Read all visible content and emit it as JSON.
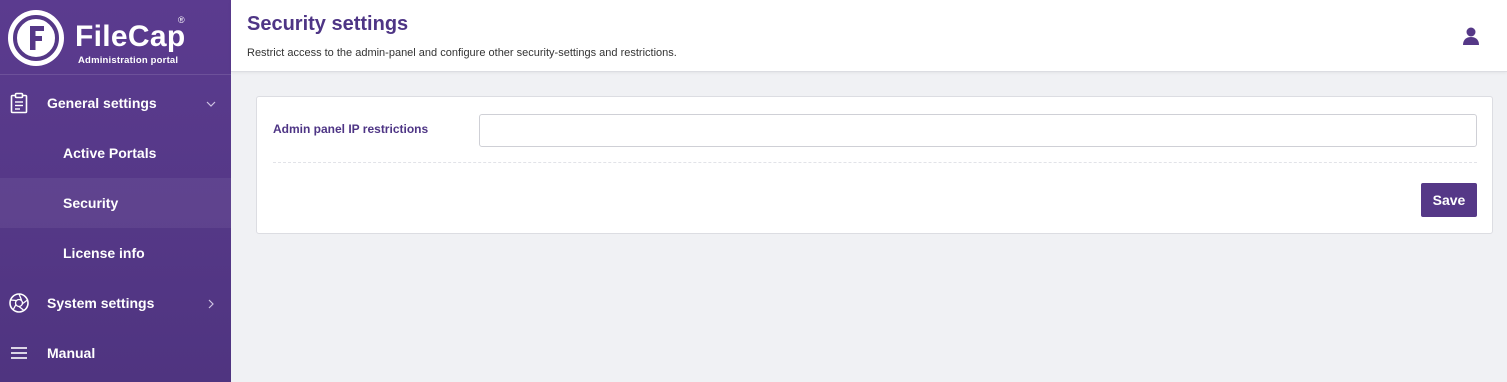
{
  "brand": {
    "name": "FileCap",
    "registered_mark": "®",
    "subtitle": "Administration portal",
    "logo_letter": "F"
  },
  "sidebar": {
    "items": [
      {
        "label": "General settings",
        "icon": "clipboard-icon",
        "expanded": true
      },
      {
        "label": "Active Portals"
      },
      {
        "label": "Security",
        "active": true
      },
      {
        "label": "License info"
      },
      {
        "label": "System settings",
        "icon": "aperture-icon",
        "expanded": false
      },
      {
        "label": "Manual",
        "icon": "hamburger-icon"
      }
    ]
  },
  "header": {
    "title": "Security settings",
    "description": "Restrict access to the admin-panel and configure other security-settings and restrictions.",
    "user_icon": "user-icon"
  },
  "form": {
    "ip_label": "Admin panel IP restrictions",
    "ip_value": "",
    "save_label": "Save"
  },
  "colors": {
    "brand_purple": "#553887",
    "title_purple": "#4e3585",
    "page_bg": "#f0f1f4"
  }
}
